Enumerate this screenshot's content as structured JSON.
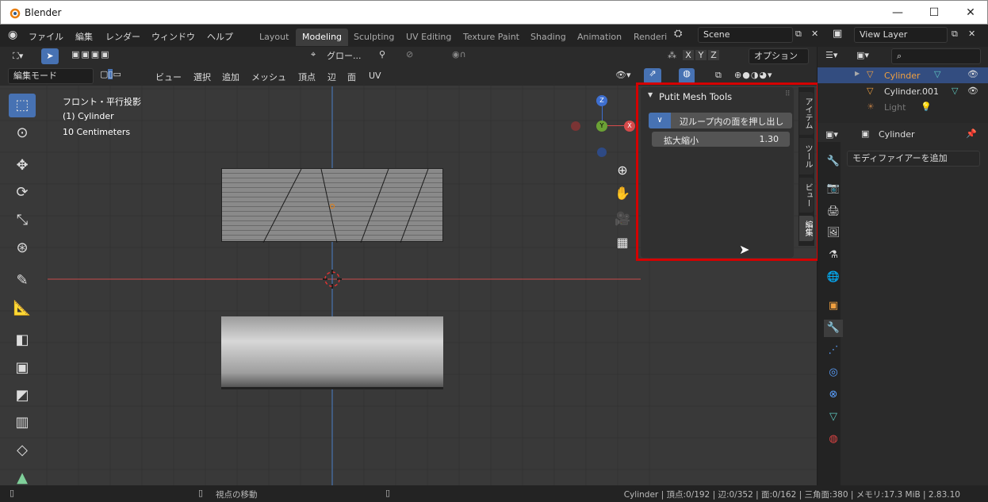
{
  "window": {
    "title": "Blender",
    "min": "—",
    "max": "☐",
    "close": "✕"
  },
  "menubar": {
    "items": [
      "ファイル",
      "編集",
      "レンダー",
      "ウィンドウ",
      "ヘルプ"
    ]
  },
  "workspaces": {
    "tabs": [
      "Layout",
      "Modeling",
      "Sculpting",
      "UV Editing",
      "Texture Paint",
      "Shading",
      "Animation",
      "Renderi"
    ],
    "active": "Modeling"
  },
  "scene": {
    "name": "Scene"
  },
  "view_layer": {
    "name": "View Layer"
  },
  "header": {
    "transform_orientation": "グロー...",
    "options": "オプション",
    "axes": [
      "X",
      "Y",
      "Z"
    ],
    "mode": "編集モード",
    "menus": [
      "ビュー",
      "選択",
      "追加",
      "メッシュ",
      "頂点",
      "辺",
      "面",
      "UV"
    ]
  },
  "viewport": {
    "view_name": "フロント・平行投影",
    "object": "(1) Cylinder",
    "scale": "10 Centimeters",
    "gizmo": {
      "x": "X",
      "y": "Y",
      "z": "Z"
    }
  },
  "sidebar": {
    "panel_title": "Putit Mesh Tools",
    "button_label": "辺ループ内の面を押し出し",
    "scale_label": "拡大縮小",
    "scale_value": "1.30",
    "tabs": [
      "アイテム",
      "ツール",
      "ビュー",
      "編集"
    ],
    "active_tab": "編集"
  },
  "outliner": {
    "search_placeholder": "",
    "items": [
      {
        "name": "Cylinder",
        "selected": true
      },
      {
        "name": "Cylinder.001",
        "selected": false
      },
      {
        "name": "Light",
        "selected": false
      }
    ]
  },
  "properties": {
    "object_name": "Cylinder",
    "add_modifier": "モディファイアーを追加"
  },
  "statusbar": {
    "hint": "視点の移動",
    "stats": "Cylinder | 頂点:0/192 | 辺:0/352 | 面:0/162 | 三角面:380 | メモリ:17.3 MiB | 2.83.10"
  },
  "colors": {
    "accent": "#4772b3",
    "highlight_box": "#d40000",
    "selected_text": "#f0a040"
  }
}
